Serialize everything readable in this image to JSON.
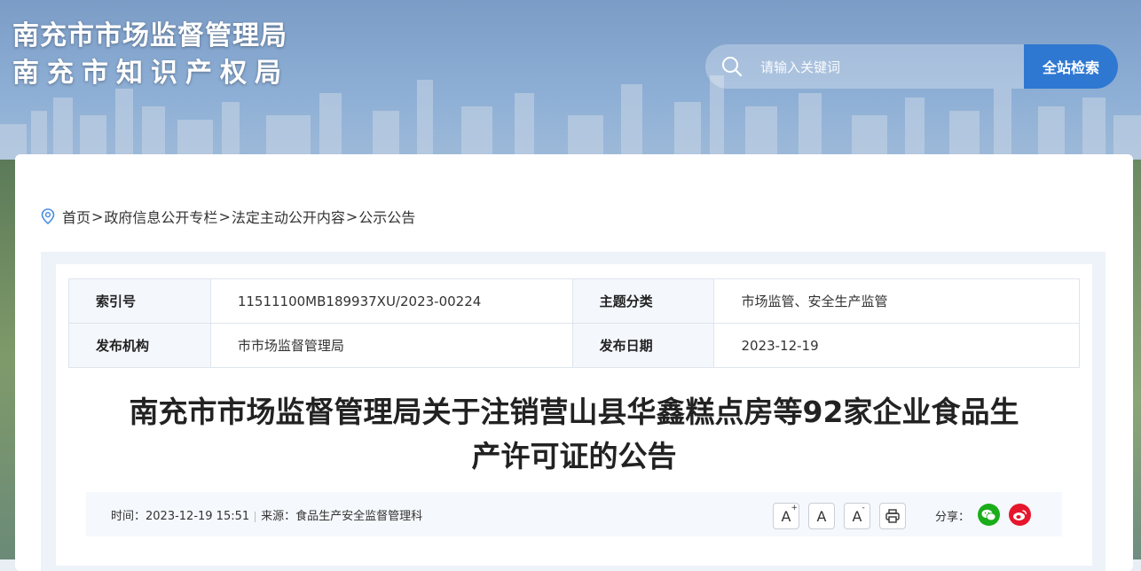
{
  "header": {
    "org_line1": "南充市市场监督管理局",
    "org_line2": "南充市知识产权局",
    "search_placeholder": "请输入关键词",
    "search_button": "全站检索"
  },
  "breadcrumb": {
    "items": [
      "首页",
      "政府信息公开专栏",
      "法定主动公开内容",
      "公示公告"
    ],
    "separator": ">"
  },
  "meta": {
    "index_label": "索引号",
    "index_value": "11511100MB189937XU/2023-00224",
    "topic_label": "主题分类",
    "topic_value": "市场监管、安全生产监管",
    "org_label": "发布机构",
    "org_value": "市市场监督管理局",
    "date_label": "发布日期",
    "date_value": "2023-12-19"
  },
  "article": {
    "title_line1": "南充市市场监督管理局关于注销营山县华鑫糕点房等92家企业食品生",
    "title_line2": "产许可证的公告",
    "time_text": "时间：2023-12-19 15:51",
    "source_text": "来源：食品生产安全监督管理科"
  },
  "toolbar": {
    "font_larger": "A",
    "font_normal": "A",
    "font_smaller": "A",
    "share_label": "分享："
  },
  "colors": {
    "accent": "#2f78d2",
    "wechat": "#1aad19",
    "weibo": "#e6162d"
  }
}
